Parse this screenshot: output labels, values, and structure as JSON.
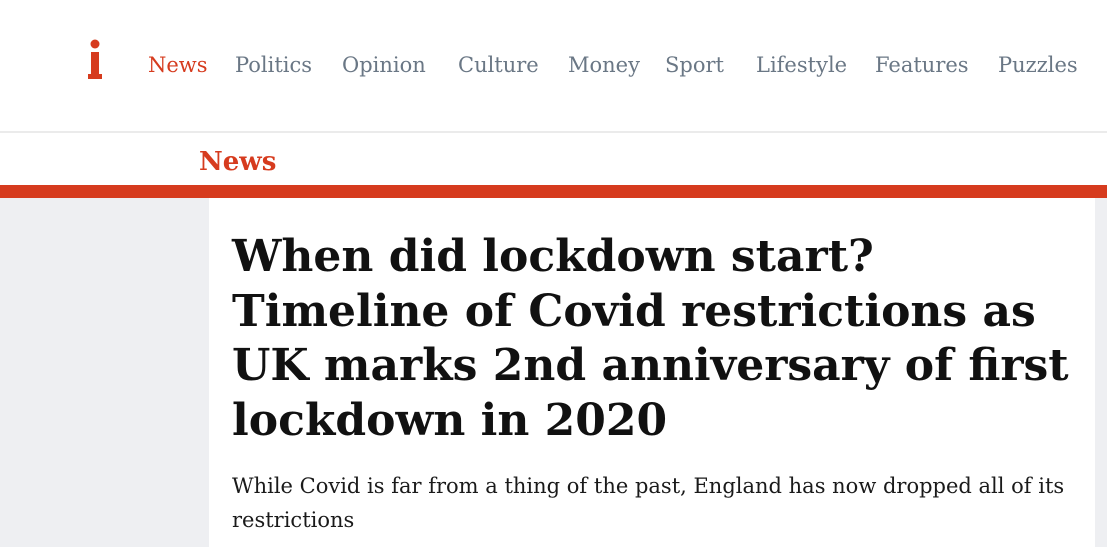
{
  "brand": {
    "logo_icon": "i-logo-icon",
    "accent_color": "#d63b1e"
  },
  "nav": {
    "items": [
      {
        "label": "News",
        "active": true
      },
      {
        "label": "Politics",
        "active": false
      },
      {
        "label": "Opinion",
        "active": false
      },
      {
        "label": "Culture",
        "active": false
      },
      {
        "label": "Money",
        "active": false
      },
      {
        "label": "Sport",
        "active": false
      },
      {
        "label": "Lifestyle",
        "active": false
      },
      {
        "label": "Features",
        "active": false
      },
      {
        "label": "Puzzles",
        "active": false
      }
    ]
  },
  "section": {
    "label": "News"
  },
  "article": {
    "headline": "When did lockdown start? Timeline of Covid restrictions as UK marks 2nd anniversary of first lockdown in 2020",
    "standfirst": "While Covid is far from a thing of the past, England has now dropped all of its restrictions"
  }
}
